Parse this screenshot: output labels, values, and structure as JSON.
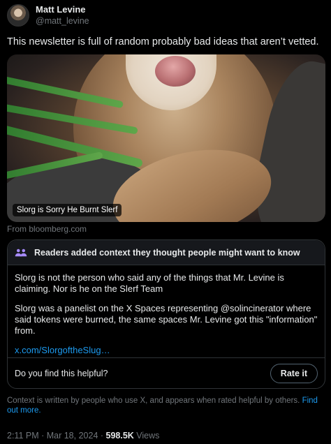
{
  "author": {
    "display_name": "Matt Levine",
    "handle": "@matt_levine"
  },
  "tweet": {
    "text": "This newsletter is full of random probably bad ideas that aren’t vetted."
  },
  "media": {
    "caption": "Slorg is Sorry He Burnt Slerf",
    "source": "From bloomberg.com"
  },
  "community_note": {
    "header": "Readers added context they thought people might want to know",
    "paragraph_1": "Slorg is not the person who said any of the things that Mr. Levine is claiming. Nor is he on the Slerf Team",
    "paragraph_2": "Slorg was a panelist on the X Spaces representing @solincinerator where said tokens were burned, the same spaces Mr. Levine got this \"information\" from.",
    "link": "x.com/SlorgoftheSlug…",
    "helpful_question": "Do you find this helpful?",
    "rate_button": "Rate it"
  },
  "disclaimer": {
    "text": "Context is written by people who use X, and appears when rated helpful by others.",
    "link": "Find out more."
  },
  "meta": {
    "timestamp": "2:11 PM · Mar 18, 2024 · ",
    "views_count": "598.5K",
    "views_label": " Views"
  },
  "colors": {
    "background": "#000000",
    "link_blue": "#1d9bf0",
    "secondary_text": "#71767b"
  }
}
